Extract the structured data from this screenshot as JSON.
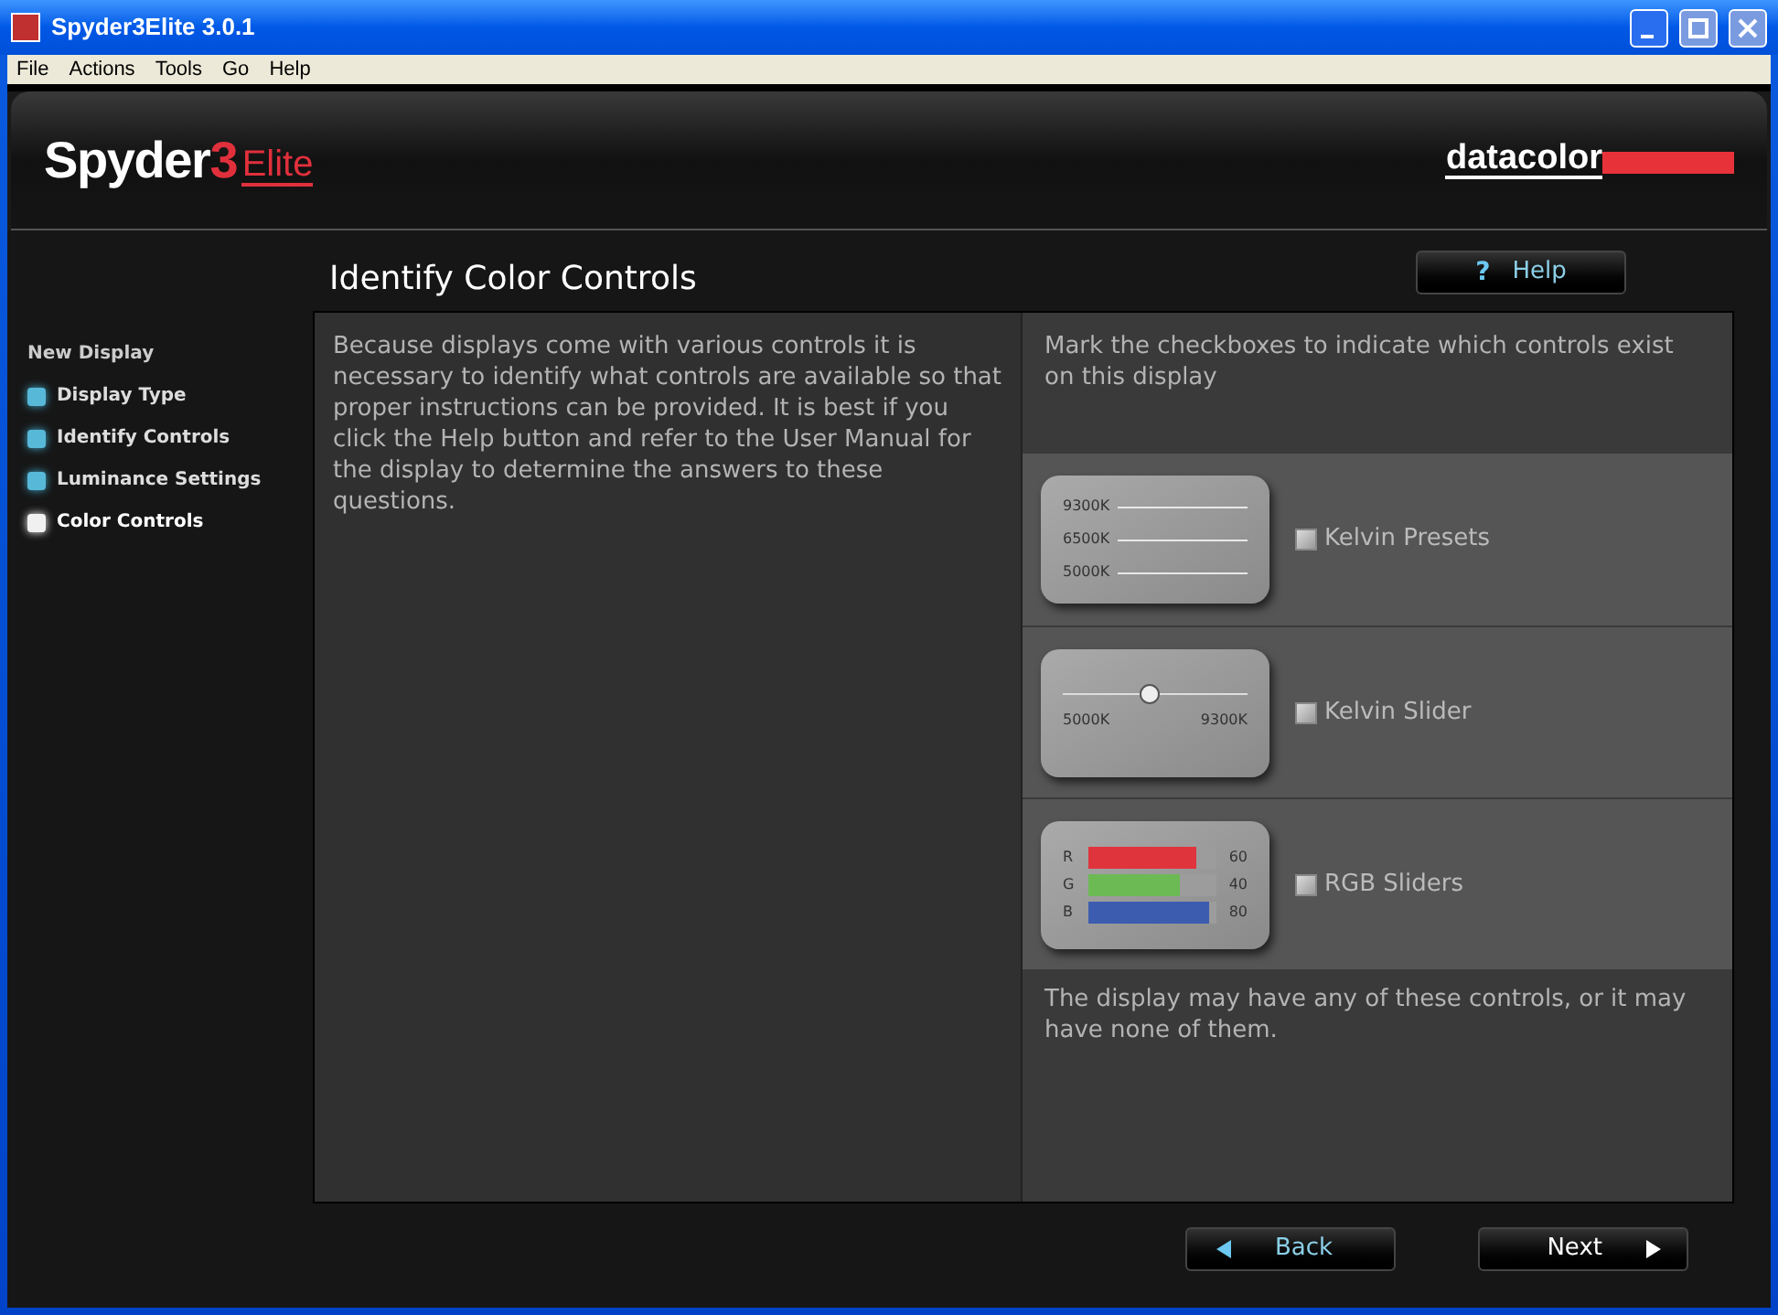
{
  "window": {
    "title": "Spyder3Elite 3.0.1"
  },
  "menu": [
    "File",
    "Actions",
    "Tools",
    "Go",
    "Help"
  ],
  "logo": {
    "brand": "Spyder",
    "number": "3",
    "edition": "Elite"
  },
  "vendor_logo": "datacolor",
  "heading": "Identify Color Controls",
  "help_button": {
    "label": "Help",
    "icon": "?"
  },
  "steps_title": "New Display",
  "steps": [
    {
      "label": "Display Type",
      "selected": false
    },
    {
      "label": "Identify Controls",
      "selected": false
    },
    {
      "label": "Luminance Settings",
      "selected": false
    },
    {
      "label": "Color Controls",
      "selected": true
    }
  ],
  "intro": "Because displays come with various controls it is necessary to identify what controls are available so that proper instructions can be provided. It is best if you click the Help button and refer to the User Manual for the display to determine the answers to these questions.",
  "instructions": "Mark the checkboxes to indicate which controls exist on this display",
  "controls": [
    {
      "kind": "presets",
      "label": "Kelvin Presets",
      "checked": false,
      "presets": [
        "9300K",
        "6500K",
        "5000K"
      ]
    },
    {
      "kind": "slider",
      "label": "Kelvin Slider",
      "checked": false,
      "min_label": "5000K",
      "max_label": "9300K",
      "level": 0.47
    },
    {
      "kind": "rgb",
      "label": "RGB Sliders",
      "checked": false,
      "bars": [
        {
          "letter": "R",
          "value": "60",
          "level": 0.84,
          "color": "#e0343c"
        },
        {
          "letter": "G",
          "value": "40",
          "level": 0.72,
          "color": "#6cba54"
        },
        {
          "letter": "B",
          "value": "80",
          "level": 0.94,
          "color": "#3c5cb0"
        }
      ]
    }
  ],
  "note": "The display may have any of these controls, or it may have none of them.",
  "buttons": {
    "back": "Back",
    "next": "Next"
  }
}
